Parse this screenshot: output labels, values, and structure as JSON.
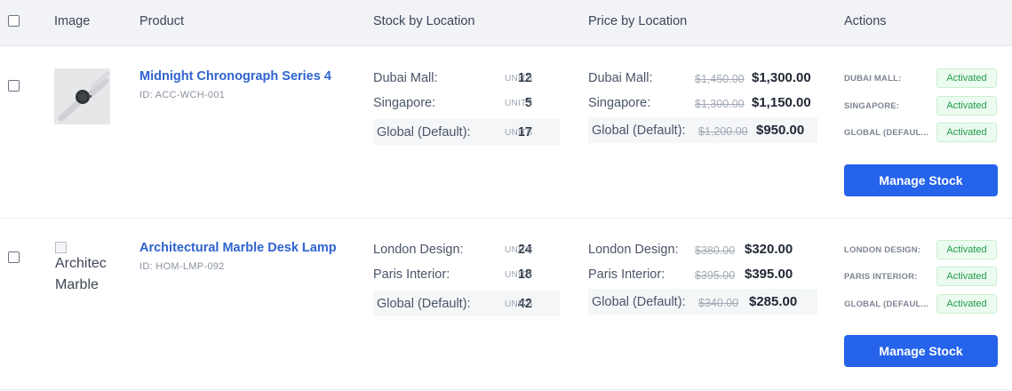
{
  "header": {
    "image": "Image",
    "product": "Product",
    "stock": "Stock by Location",
    "price": "Price by Location",
    "actions": "Actions"
  },
  "rows": [
    {
      "product_name": "Midnight Chronograph Series 4",
      "product_id": "ID: ACC-WCH-001",
      "image_alt_line1": "",
      "image_alt_line2": "",
      "stock": [
        {
          "location": "Dubai Mall:",
          "qty": "12",
          "unit": "UNITS"
        },
        {
          "location": "Singapore:",
          "qty": "5",
          "unit": "UNITS"
        },
        {
          "location": "Global (Default):",
          "qty": "17",
          "unit": "UNITS"
        }
      ],
      "prices": [
        {
          "location": "Dubai Mall:",
          "old": "$1,450.00",
          "new": "$1,300.00"
        },
        {
          "location": "Singapore:",
          "old": "$1,300.00",
          "new": "$1,150.00"
        },
        {
          "location": "Global (Default):",
          "old": "$1,200.00",
          "new": "$950.00"
        }
      ],
      "actions": [
        {
          "location": "DUBAI MALL:",
          "status": "Activated"
        },
        {
          "location": "SINGAPORE:",
          "status": "Activated"
        },
        {
          "location": "GLOBAL (DEFAUL...",
          "status": "Activated"
        }
      ],
      "button": "Manage Stock"
    },
    {
      "product_name": "Architectural Marble Desk Lamp",
      "product_id": "ID: HOM-LMP-092",
      "image_alt_line1": "Architec",
      "image_alt_line2": "Marble",
      "stock": [
        {
          "location": "London Design:",
          "qty": "24",
          "unit": "UNITS"
        },
        {
          "location": "Paris Interior:",
          "qty": "18",
          "unit": "UNITS"
        },
        {
          "location": "Global (Default):",
          "qty": "42",
          "unit": "UNITS"
        }
      ],
      "prices": [
        {
          "location": "London Design:",
          "old": "$380.00",
          "new": "$320.00"
        },
        {
          "location": "Paris Interior:",
          "old": "$395.00",
          "new": "$395.00"
        },
        {
          "location": "Global (Default):",
          "old": "$340.00",
          "new": "$285.00"
        }
      ],
      "actions": [
        {
          "location": "LONDON DESIGN:",
          "status": "Activated"
        },
        {
          "location": "PARIS INTERIOR:",
          "status": "Activated"
        },
        {
          "location": "GLOBAL (DEFAUL...",
          "status": "Activated"
        }
      ],
      "button": "Manage Stock"
    }
  ]
}
